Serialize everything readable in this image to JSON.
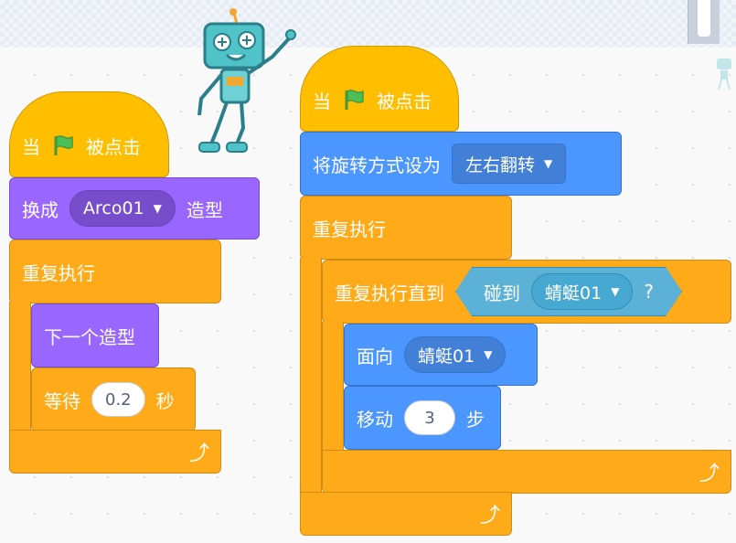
{
  "colors": {
    "events": "#ffbf00",
    "control": "#ffab19",
    "looks": "#9966ff",
    "motion": "#4c97ff",
    "sensing": "#5cb1d6",
    "flag": "#4cbf56"
  },
  "icons": {
    "flag": "green-flag-icon",
    "loop": "loop-arrow-icon",
    "dropdown": "caret-down-icon"
  },
  "script_left": {
    "hat": {
      "when": "当",
      "clicked": "被点击"
    },
    "switch_costume": {
      "label": "换成",
      "value": "Arco01",
      "suffix": "造型"
    },
    "forever": {
      "label": "重复执行"
    },
    "next_costume": {
      "label": "下一个造型"
    },
    "wait": {
      "label": "等待",
      "value": "0.2",
      "unit": "秒"
    }
  },
  "script_right": {
    "hat": {
      "when": "当",
      "clicked": "被点击"
    },
    "rotation_style": {
      "label": "将旋转方式设为",
      "value": "左右翻转"
    },
    "forever": {
      "label": "重复执行"
    },
    "repeat_until": {
      "label": "重复执行直到"
    },
    "touching": {
      "label": "碰到",
      "value": "蜻蜓01",
      "suffix": "?"
    },
    "point_towards": {
      "label": "面向",
      "value": "蜻蜓01"
    },
    "move": {
      "label": "移动",
      "value": "3",
      "unit": "步"
    }
  }
}
